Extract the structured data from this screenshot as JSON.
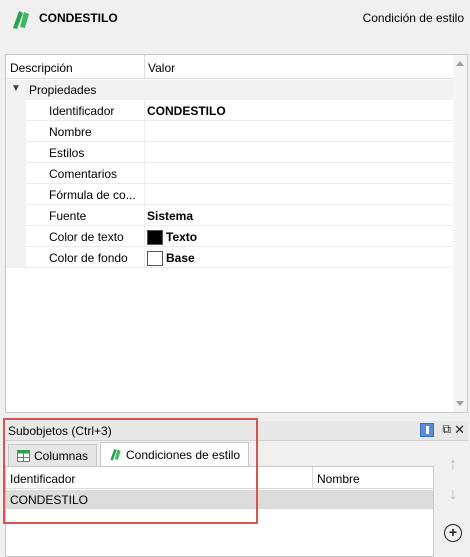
{
  "header": {
    "object_name": "CONDESTILO",
    "object_type": "Condición de estilo",
    "logo_icon": "style-condition-icon",
    "brand_color": "#2e9e52"
  },
  "properties": {
    "columns": [
      "Descripción",
      "Valor"
    ],
    "group": {
      "label": "Propiedades",
      "toggle_icon": "chevron-down-icon"
    },
    "rows": [
      {
        "name": "Identificador",
        "value": "CONDESTILO"
      },
      {
        "name": "Nombre",
        "value": ""
      },
      {
        "name": "Estilos",
        "value": ""
      },
      {
        "name": "Comentarios",
        "value": ""
      },
      {
        "name": "Fórmula de co...",
        "value": ""
      },
      {
        "name": "Fuente",
        "value": "Sistema"
      },
      {
        "name": "Color de texto",
        "value": "Texto",
        "swatch": "#000000"
      },
      {
        "name": "Color de fondo",
        "value": "Base",
        "swatch": "#ffffff"
      }
    ]
  },
  "subobjects": {
    "title": "Subobjetos (Ctrl+3)",
    "tabs": [
      {
        "label": "Columnas",
        "icon": "table-icon",
        "icon_color": "#2e9e52",
        "active": false
      },
      {
        "label": "Condiciones de estilo",
        "icon": "style-condition-icon",
        "icon_color": "#2e9e52",
        "active": true
      }
    ],
    "grid": {
      "columns": [
        "Identificador",
        "Nombre"
      ],
      "rows": [
        {
          "identificador": "CONDESTILO",
          "nombre": ""
        }
      ]
    },
    "tools": [
      "arrow-up-icon",
      "arrow-down-icon",
      "add-icon"
    ],
    "highlight_color": "#d9534f"
  }
}
